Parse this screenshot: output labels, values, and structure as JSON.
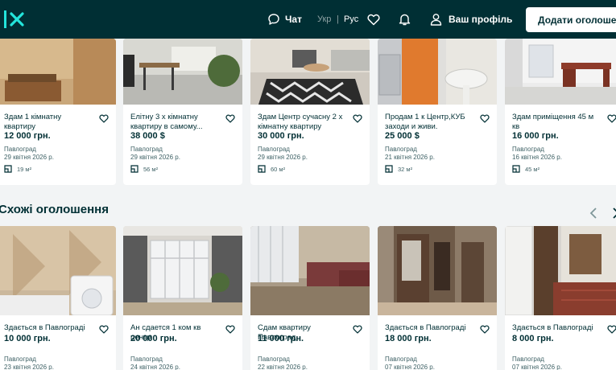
{
  "header": {
    "chat_label": "Чат",
    "lang_ukr": "Укр",
    "lang_sep": "|",
    "lang_rus": "Рус",
    "profile_label": "Ваш профіль",
    "add_button_label": "Додати оголошення"
  },
  "top_listings": [
    {
      "title": "Здам 1 кімнатну квартиру",
      "price": "12 000 грн.",
      "city": "Павлоград",
      "date": "29 квітня 2026 р.",
      "area": "19 м²"
    },
    {
      "title": "Елітну 3 х кімнатну квартиру в самому...",
      "price": "38 000 $",
      "city": "Павлоград",
      "date": "29 квітня 2026 р.",
      "area": "56 м²"
    },
    {
      "title": "Здам Центр сучасну 2 х кімнатну квартиру",
      "price": "30 000 грн.",
      "city": "Павлоград",
      "date": "29 квітня 2026 р.",
      "area": "60 м²"
    },
    {
      "title": "Продам 1 к Центр,КУБ заходи и живи.",
      "price": "25 000 $",
      "city": "Павлоград",
      "date": "21 квітня 2026 р.",
      "area": "32 м²"
    },
    {
      "title": "Здам приміщення 45 м кв",
      "price": "16 000 грн.",
      "city": "Павлоград",
      "date": "16 квітня 2026 р.",
      "area": "45 м²"
    }
  ],
  "similar_section": {
    "title": "Схожі оголошення"
  },
  "similar_listings": [
    {
      "title": "Здається в Павлограді",
      "price": "10 000 грн.",
      "city": "Павлоград",
      "date": "23 квітня 2026 р."
    },
    {
      "title": "Ан сдается 1 ком кв центр",
      "price": "20 000 грн.",
      "city": "Павлоград",
      "date": "24 квітня 2026 р."
    },
    {
      "title": "Сдам квартиру Павлоград",
      "price": "11 000 грн.",
      "city": "Павлоград",
      "date": "22 квітня 2026 р."
    },
    {
      "title": "Здається в Павлограді",
      "price": "18 000 грн.",
      "city": "Павлоград",
      "date": "07 квітня 2026 р."
    },
    {
      "title": "Здається в Павлограді",
      "price": "8 000 грн.",
      "city": "Павлоград",
      "date": "07 квітня 2026 р."
    }
  ],
  "colors": {
    "header_bg": "#002f34",
    "accent": "#23e5db",
    "page_bg": "#f2f4f5"
  },
  "icons": {
    "logo": "olx-logo",
    "chat": "chat-bubble-icon",
    "favorites": "heart-icon",
    "notifications": "bell-icon",
    "profile": "user-icon",
    "area": "floor-plan-icon",
    "prev": "chevron-left-icon",
    "next": "chevron-right-icon"
  }
}
